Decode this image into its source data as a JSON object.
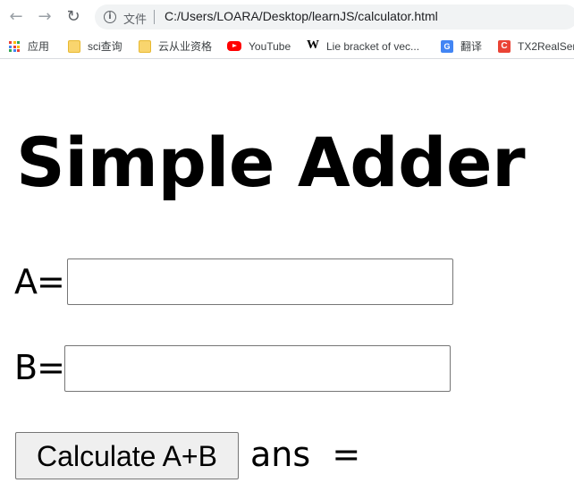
{
  "browser": {
    "scheme_label": "文件",
    "url": "C:/Users/LOARA/Desktop/learnJS/calculator.html",
    "bookmarks": [
      {
        "label": "应用",
        "icon": "apps-grid-icon"
      },
      {
        "label": "sci查询",
        "icon": "folder-icon"
      },
      {
        "label": "云从业资格",
        "icon": "folder-icon"
      },
      {
        "label": "YouTube",
        "icon": "youtube-icon"
      },
      {
        "label": "Lie bracket of vec...",
        "icon": "wikipedia-icon"
      },
      {
        "label": "翻译",
        "icon": "google-translate-icon"
      },
      {
        "label": "TX2RealSer",
        "icon": "tx2-icon"
      }
    ]
  },
  "page": {
    "title": "Simple Adder",
    "label_a": "A=",
    "label_b": "B=",
    "input_a_value": "",
    "input_b_value": "",
    "calculate_button": "Calculate A+B",
    "answer_label": "ans  ="
  }
}
